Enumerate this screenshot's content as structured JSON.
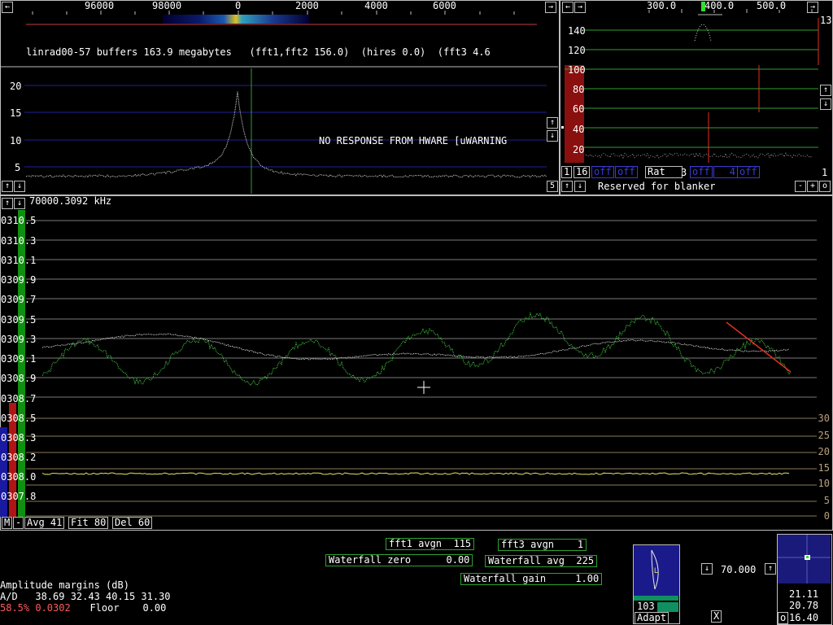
{
  "wide": {
    "freq_ticks": [
      "96000",
      "98000",
      "0",
      "2000",
      "4000",
      "6000"
    ],
    "status": "linrad00-57 buffers 163.9 megabytes   (fft1,fft2 156.0)  (hires 0.0)  (fft3 4.6",
    "warning": "NO RESPONSE FROM HWARE [uWARNING",
    "yticks": [
      "20",
      "15",
      "10",
      "5"
    ],
    "corner_value": "5"
  },
  "afc": {
    "freq_ticks": [
      "300.0",
      "400.0",
      "500.0"
    ],
    "yticks": [
      "140",
      "120",
      "100",
      "80",
      "60",
      "40",
      "20"
    ],
    "corner_top": "13",
    "corner_bottom": "1",
    "ctrl": {
      "ch1": "1",
      "ch16": "16",
      "off1": "off",
      "off2": "off",
      "rat_label": "Rat",
      "rat_value": "3",
      "off3": "off",
      "num4": "4",
      "off4": "off"
    },
    "blanker_label": "Reserved for blanker",
    "minus": "-",
    "plus": "+",
    "zero": "o"
  },
  "main": {
    "freq_readout": "70000.3092 kHz",
    "yticks": [
      "0310.5",
      "0310.3",
      "0310.1",
      "0309.9",
      "0309.7",
      "0309.5",
      "0309.3",
      "0309.1",
      "0308.9",
      "0308.7",
      "0308.5",
      "0308.3",
      "0308.2",
      "0308.0",
      "0307.8"
    ],
    "rticks": [
      "30",
      "25",
      "20",
      "15",
      "10",
      "5",
      "0"
    ],
    "m_btn": "M",
    "minus_btn": "-",
    "avg": "Avg 41",
    "fit": "Fit 80",
    "del": "Del 60"
  },
  "bottom": {
    "fft1_avgn": "fft1 avgn  115",
    "fft3_avgn": "fft3 avgn    1",
    "wf_zero": "Waterfall zero      0.00",
    "wf_avg": "Waterfall avg  225",
    "wf_gain": "Waterfall gain     1.00",
    "amp_title": "Amplitude margins (dB)",
    "ad_line": "A/D   38.69 32.43 40.15 31.30",
    "pct": "58.5% 0.0302",
    "floor": "  Floor    0.00",
    "adapt_num": "103",
    "adapt_label": "Adapt",
    "x_btn": "X",
    "freq_box": "70.000",
    "s_vals": [
      "21.11",
      "20.78",
      "16.40"
    ],
    "o_btn": "o"
  },
  "colors": {
    "grid_blue": "#2020a0",
    "grid_green": "#2fa12f",
    "trace_green": "#3fcf3f",
    "trace_white": "#e8e8e8",
    "red": "#e03020",
    "dark_red": "#8a0f0f",
    "yellow_trace": "#e6e65a",
    "tan": "#b8a07a",
    "bar_blue": "#1a1aa0",
    "bar_red": "#b01515",
    "bar_green": "#109010"
  },
  "icons": [
    "arrow-left-icon",
    "arrow-right-icon",
    "arrow-up-icon",
    "arrow-down-icon",
    "marker-icon",
    "moon-phase-icon"
  ]
}
